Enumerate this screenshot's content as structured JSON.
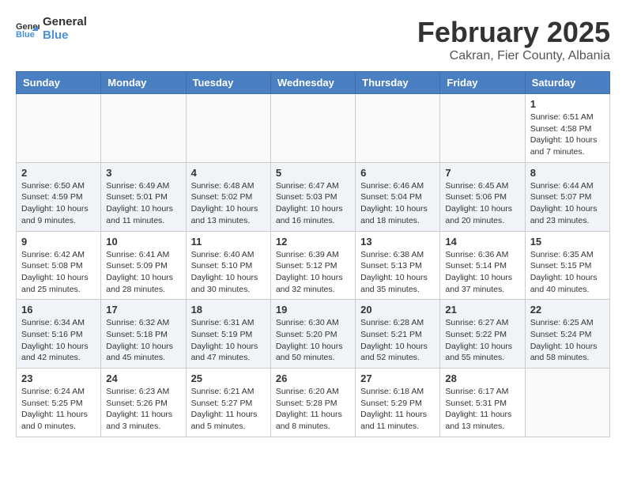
{
  "logo": {
    "general": "General",
    "blue": "Blue"
  },
  "title": {
    "month": "February 2025",
    "location": "Cakran, Fier County, Albania"
  },
  "weekdays": [
    "Sunday",
    "Monday",
    "Tuesday",
    "Wednesday",
    "Thursday",
    "Friday",
    "Saturday"
  ],
  "weeks": [
    [
      {
        "day": "",
        "info": ""
      },
      {
        "day": "",
        "info": ""
      },
      {
        "day": "",
        "info": ""
      },
      {
        "day": "",
        "info": ""
      },
      {
        "day": "",
        "info": ""
      },
      {
        "day": "",
        "info": ""
      },
      {
        "day": "1",
        "info": "Sunrise: 6:51 AM\nSunset: 4:58 PM\nDaylight: 10 hours and 7 minutes."
      }
    ],
    [
      {
        "day": "2",
        "info": "Sunrise: 6:50 AM\nSunset: 4:59 PM\nDaylight: 10 hours and 9 minutes."
      },
      {
        "day": "3",
        "info": "Sunrise: 6:49 AM\nSunset: 5:01 PM\nDaylight: 10 hours and 11 minutes."
      },
      {
        "day": "4",
        "info": "Sunrise: 6:48 AM\nSunset: 5:02 PM\nDaylight: 10 hours and 13 minutes."
      },
      {
        "day": "5",
        "info": "Sunrise: 6:47 AM\nSunset: 5:03 PM\nDaylight: 10 hours and 16 minutes."
      },
      {
        "day": "6",
        "info": "Sunrise: 6:46 AM\nSunset: 5:04 PM\nDaylight: 10 hours and 18 minutes."
      },
      {
        "day": "7",
        "info": "Sunrise: 6:45 AM\nSunset: 5:06 PM\nDaylight: 10 hours and 20 minutes."
      },
      {
        "day": "8",
        "info": "Sunrise: 6:44 AM\nSunset: 5:07 PM\nDaylight: 10 hours and 23 minutes."
      }
    ],
    [
      {
        "day": "9",
        "info": "Sunrise: 6:42 AM\nSunset: 5:08 PM\nDaylight: 10 hours and 25 minutes."
      },
      {
        "day": "10",
        "info": "Sunrise: 6:41 AM\nSunset: 5:09 PM\nDaylight: 10 hours and 28 minutes."
      },
      {
        "day": "11",
        "info": "Sunrise: 6:40 AM\nSunset: 5:10 PM\nDaylight: 10 hours and 30 minutes."
      },
      {
        "day": "12",
        "info": "Sunrise: 6:39 AM\nSunset: 5:12 PM\nDaylight: 10 hours and 32 minutes."
      },
      {
        "day": "13",
        "info": "Sunrise: 6:38 AM\nSunset: 5:13 PM\nDaylight: 10 hours and 35 minutes."
      },
      {
        "day": "14",
        "info": "Sunrise: 6:36 AM\nSunset: 5:14 PM\nDaylight: 10 hours and 37 minutes."
      },
      {
        "day": "15",
        "info": "Sunrise: 6:35 AM\nSunset: 5:15 PM\nDaylight: 10 hours and 40 minutes."
      }
    ],
    [
      {
        "day": "16",
        "info": "Sunrise: 6:34 AM\nSunset: 5:16 PM\nDaylight: 10 hours and 42 minutes."
      },
      {
        "day": "17",
        "info": "Sunrise: 6:32 AM\nSunset: 5:18 PM\nDaylight: 10 hours and 45 minutes."
      },
      {
        "day": "18",
        "info": "Sunrise: 6:31 AM\nSunset: 5:19 PM\nDaylight: 10 hours and 47 minutes."
      },
      {
        "day": "19",
        "info": "Sunrise: 6:30 AM\nSunset: 5:20 PM\nDaylight: 10 hours and 50 minutes."
      },
      {
        "day": "20",
        "info": "Sunrise: 6:28 AM\nSunset: 5:21 PM\nDaylight: 10 hours and 52 minutes."
      },
      {
        "day": "21",
        "info": "Sunrise: 6:27 AM\nSunset: 5:22 PM\nDaylight: 10 hours and 55 minutes."
      },
      {
        "day": "22",
        "info": "Sunrise: 6:25 AM\nSunset: 5:24 PM\nDaylight: 10 hours and 58 minutes."
      }
    ],
    [
      {
        "day": "23",
        "info": "Sunrise: 6:24 AM\nSunset: 5:25 PM\nDaylight: 11 hours and 0 minutes."
      },
      {
        "day": "24",
        "info": "Sunrise: 6:23 AM\nSunset: 5:26 PM\nDaylight: 11 hours and 3 minutes."
      },
      {
        "day": "25",
        "info": "Sunrise: 6:21 AM\nSunset: 5:27 PM\nDaylight: 11 hours and 5 minutes."
      },
      {
        "day": "26",
        "info": "Sunrise: 6:20 AM\nSunset: 5:28 PM\nDaylight: 11 hours and 8 minutes."
      },
      {
        "day": "27",
        "info": "Sunrise: 6:18 AM\nSunset: 5:29 PM\nDaylight: 11 hours and 11 minutes."
      },
      {
        "day": "28",
        "info": "Sunrise: 6:17 AM\nSunset: 5:31 PM\nDaylight: 11 hours and 13 minutes."
      },
      {
        "day": "",
        "info": ""
      }
    ]
  ]
}
